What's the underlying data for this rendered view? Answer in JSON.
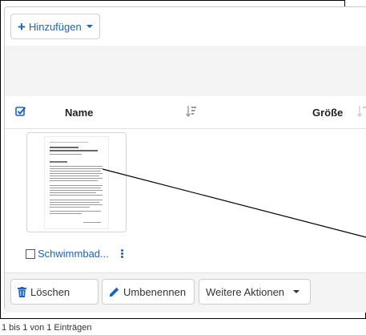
{
  "toolbar": {
    "add_label": "Hinzufügen",
    "add_icon": "plus-icon"
  },
  "table": {
    "columns": [
      "Name",
      "Größe"
    ],
    "select_all_icon": "check-square-icon",
    "sort_icon": "sort-amount-down-icon"
  },
  "files": [
    {
      "name": "Schwimmbad...",
      "type": "document",
      "thumbnail_icon": "document-thumbnail"
    }
  ],
  "actions": {
    "delete_label": "Löschen",
    "rename_label": "Umbenennen",
    "more_label": "Weitere Aktionen"
  },
  "footer": {
    "summary": "1 bis 1 von 1 Einträgen"
  },
  "colors": {
    "accent": "#1f63b8",
    "band": "#f4f4f4",
    "border": "#c8c8c8"
  }
}
